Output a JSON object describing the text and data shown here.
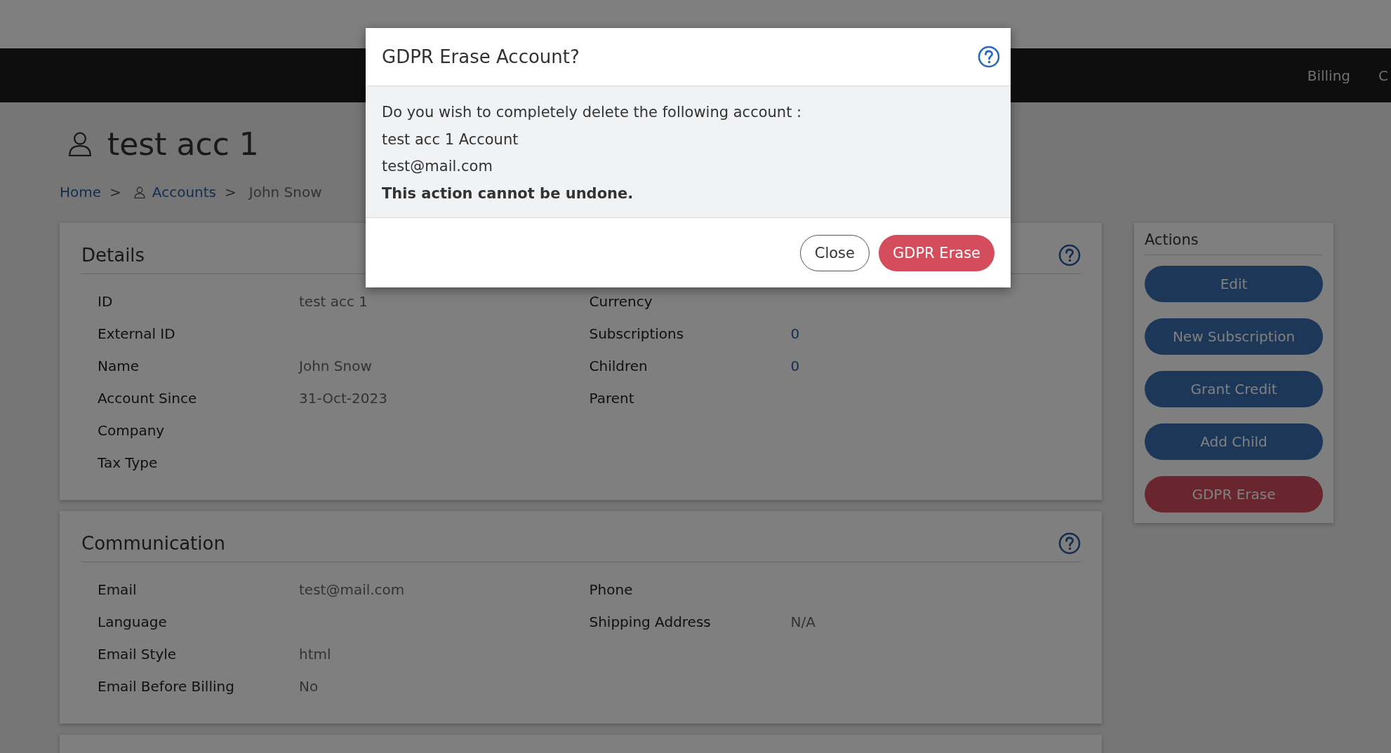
{
  "nav": {
    "items": [
      "Billing",
      "C"
    ]
  },
  "page": {
    "title": "test acc 1",
    "breadcrumb": [
      {
        "label": "Home",
        "kind": "link"
      },
      {
        "label": ">",
        "kind": "separator"
      },
      {
        "label": "Accounts",
        "kind": "link-icon"
      },
      {
        "label": ">",
        "kind": "separator"
      },
      {
        "label": "John Snow",
        "kind": "current"
      }
    ]
  },
  "details": {
    "title": "Details",
    "left": [
      {
        "label": "ID",
        "value": "test acc 1"
      },
      {
        "label": "External ID"
      },
      {
        "label": "Name",
        "value": "John Snow"
      },
      {
        "label": "Account Since",
        "value": "31-Oct-2023"
      },
      {
        "label": "Company"
      },
      {
        "label": "Tax Type"
      }
    ],
    "right": [
      {
        "label": "Currency"
      },
      {
        "label": "Subscriptions",
        "value": "0",
        "kind": "link"
      },
      {
        "label": "Children",
        "value": "0",
        "kind": "link"
      },
      {
        "label": "Parent"
      }
    ]
  },
  "communication": {
    "title": "Communication",
    "left": [
      {
        "label": "Email",
        "value": "test@mail.com"
      },
      {
        "label": "Language"
      },
      {
        "label": "Email Style",
        "value": "html"
      },
      {
        "label": "Email Before Billing",
        "value": "No"
      }
    ],
    "right": [
      {
        "label": "Phone"
      },
      {
        "label": "Shipping Address",
        "value": "N/A"
      }
    ]
  },
  "actions": {
    "title": "Actions",
    "buttons": [
      {
        "label": "Edit",
        "kind": "primary"
      },
      {
        "label": "New Subscription",
        "kind": "primary"
      },
      {
        "label": "Grant Credit",
        "kind": "primary"
      },
      {
        "label": "Add Child",
        "kind": "primary"
      },
      {
        "label": "GDPR Erase",
        "kind": "danger"
      }
    ]
  },
  "modal": {
    "title": "GDPR Erase Account?",
    "lines": [
      {
        "text": "Do you wish to completely delete the following account :",
        "kind": "normal"
      },
      {
        "text": "test acc 1 Account",
        "kind": "normal"
      },
      {
        "text": "test@mail.com",
        "kind": "normal"
      },
      {
        "text": "This action cannot be undone.",
        "kind": "strong"
      }
    ],
    "buttons": [
      {
        "label": "Close",
        "kind": "outline"
      },
      {
        "label": "GDPR Erase",
        "kind": "danger"
      }
    ]
  }
}
